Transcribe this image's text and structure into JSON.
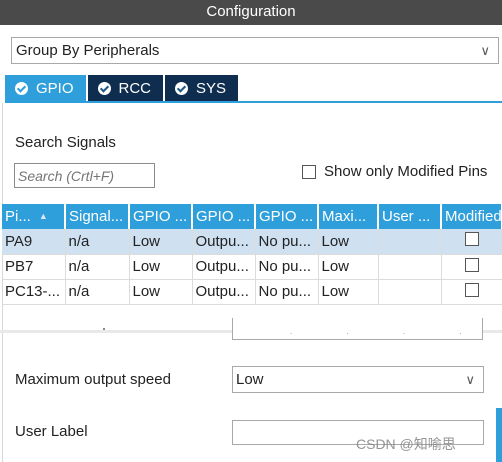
{
  "window": {
    "title": "Configuration"
  },
  "group_by": {
    "value": "Group By Peripherals"
  },
  "tabs": [
    {
      "label": "GPIO",
      "active": true
    },
    {
      "label": "RCC",
      "active": false
    },
    {
      "label": "SYS",
      "active": false
    }
  ],
  "search": {
    "label": "Search Signals",
    "placeholder": "Search (Crtl+F)"
  },
  "show_modified": {
    "label": "Show only Modified Pins",
    "checked": false
  },
  "table": {
    "headers": [
      "Pi...",
      "Signal...",
      "GPIO ...",
      "GPIO ...",
      "GPIO ...",
      "Maxi...",
      "User ...",
      "Modified"
    ],
    "rows": [
      [
        "PA9",
        "n/a",
        "Low",
        "Outpu...",
        "No pu...",
        "Low",
        "",
        ""
      ],
      [
        "PB7",
        "n/a",
        "Low",
        "Outpu...",
        "No pu...",
        "Low",
        "",
        ""
      ],
      [
        "PC13-...",
        "n/a",
        "Low",
        "Outpu...",
        "No pu...",
        "Low",
        "",
        ""
      ]
    ],
    "selected_row": 0
  },
  "config": {
    "max_speed_label": "Maximum output speed",
    "max_speed_value": "Low",
    "user_label_label": "User Label",
    "user_label_value": ""
  },
  "watermark": "CSDN @知喻思",
  "colors": {
    "accent": "#2f9fdc",
    "tab_inactive": "#0f2d4f",
    "selected_row": "#cfe0f1",
    "titlebar": "#4a4a4a"
  }
}
